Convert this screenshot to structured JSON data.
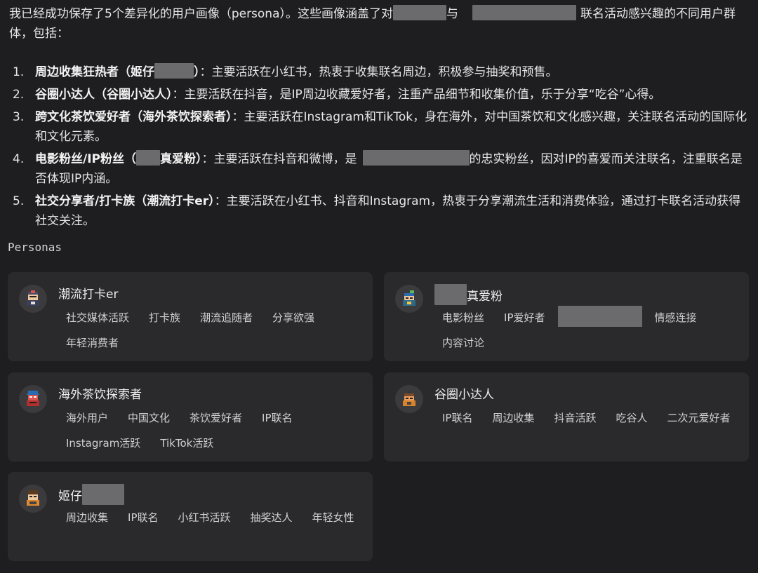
{
  "intro": {
    "part1": "我已经成功保存了5个差异化的用户画像（persona）。这些画像涵盖了对",
    "part2": "与",
    "part3": "联名活动感兴趣的不同用户群体，包括："
  },
  "list": [
    {
      "num": "1.",
      "name_a": "周边收集狂热者（姬仔",
      "name_b": "）",
      "desc": "：主要活跃在小红书，热衷于收集联名周边，积极参与抽奖和预售。"
    },
    {
      "num": "2.",
      "name": "谷圈小达人（谷圈小达人）",
      "desc": "：主要活跃在抖音，是IP周边收藏爱好者，注重产品细节和收集价值，乐于分享“吃谷”心得。"
    },
    {
      "num": "3.",
      "name": "跨文化茶饮爱好者（海外茶饮探索者）",
      "desc": "：主要活跃在Instagram和TikTok，身在海外，对中国茶饮和文化感兴趣，关注联名活动的国际化和文化元素。"
    },
    {
      "num": "4.",
      "name_a": "电影粉丝/IP粉丝（",
      "name_b": "真爱粉）",
      "desc_a": "：主要活跃在抖音和微博，是",
      "desc_b": "的忠实粉丝，因对IP的喜爱而关注联名，注重联名是否体现IP内涵。"
    },
    {
      "num": "5.",
      "name": "社交分享者/打卡族（潮流打卡er）",
      "desc": "：主要活跃在小红书、抖音和Instagram，热衷于分享潮流生活和消费体验，通过打卡联名活动获得社交关注。"
    }
  ],
  "section_title": "Personas",
  "cards": [
    {
      "name": "潮流打卡er",
      "icon": "pixel-avatar-icon",
      "tags": [
        "社交媒体活跃",
        "打卡族",
        "潮流追随者",
        "分享欲强",
        "年轻消费者"
      ]
    },
    {
      "name": "真爱粉",
      "icon": "pixel-avatar-icon",
      "tags": [
        "电影粉丝",
        "IP爱好者",
        "情感连接",
        "内容讨论"
      ]
    },
    {
      "name": "海外茶饮探索者",
      "icon": "pixel-avatar-icon",
      "tags": [
        "海外用户",
        "中国文化",
        "茶饮爱好者",
        "IP联名",
        "Instagram活跃",
        "TikTok活跃"
      ]
    },
    {
      "name": "谷圈小达人",
      "icon": "pixel-avatar-icon",
      "tags": [
        "IP联名",
        "周边收集",
        "抖音活跃",
        "吃谷人",
        "二次元爱好者"
      ]
    },
    {
      "name": "姬仔",
      "icon": "pixel-avatar-icon",
      "tags": [
        "周边收集",
        "IP联名",
        "小红书活跃",
        "抽奖达人",
        "年轻女性"
      ]
    }
  ]
}
